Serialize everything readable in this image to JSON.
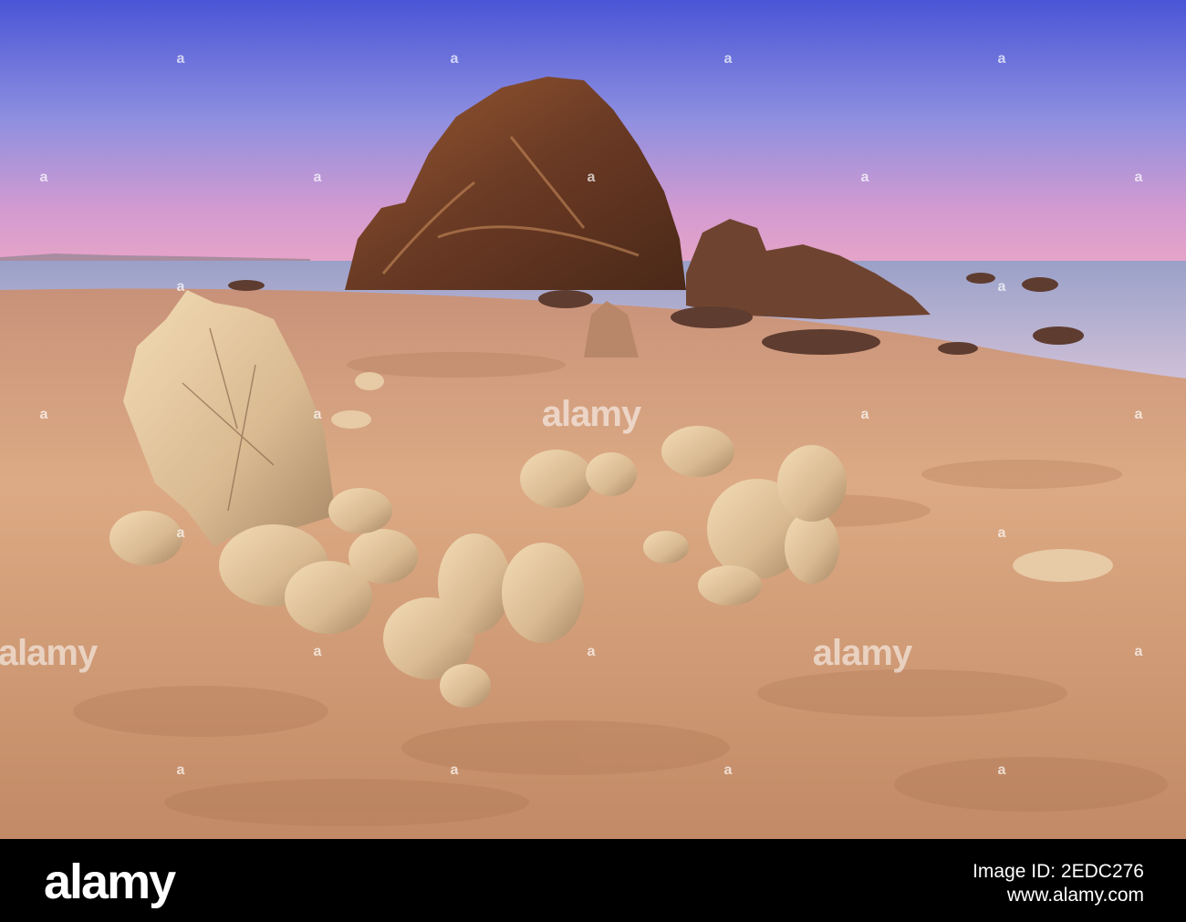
{
  "watermark": {
    "word": "alamy",
    "mark": "a"
  },
  "footer": {
    "brand": "alamy",
    "image_id": "Image ID: 2EDC276",
    "url": "www.alamy.com"
  },
  "colors": {
    "sky_top": "#4a55d6",
    "sky_horizon": "#e6a4c8",
    "sand": "#d6a47e",
    "rock_dark": "#6a3a24",
    "boulder_light": "#e4c9a2",
    "sea": "#b2aed0",
    "footer_bg": "#000000"
  }
}
